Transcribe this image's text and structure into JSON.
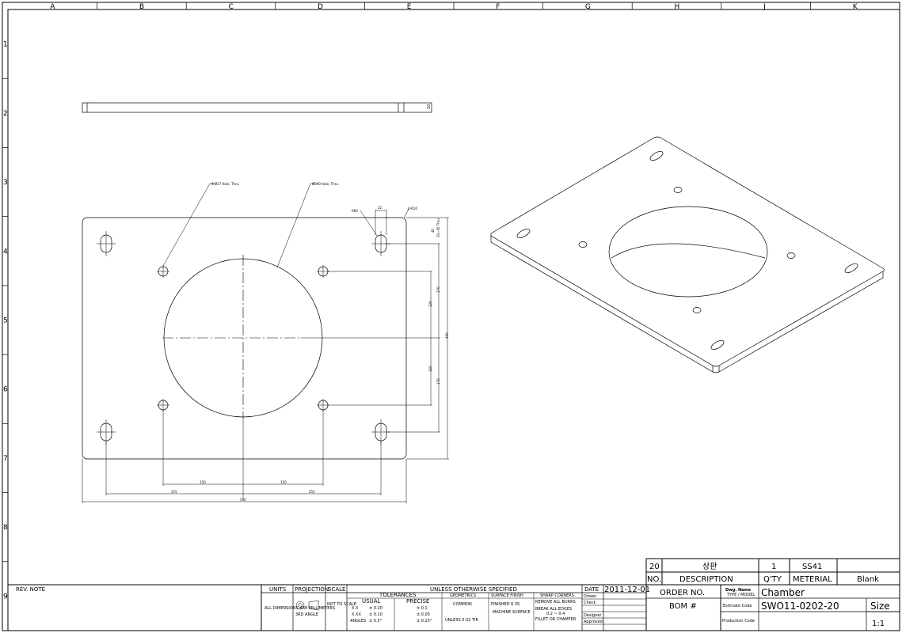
{
  "grid": {
    "columns": [
      "A",
      "B",
      "C",
      "D",
      "E",
      "F",
      "G",
      "H",
      "J",
      "K"
    ],
    "rows": [
      "1",
      "2",
      "3",
      "4",
      "5",
      "6",
      "7",
      "8",
      "9"
    ]
  },
  "annotations": {
    "hole_small": "4-Ø17 Hole, Thru.",
    "hole_large": "Ø390 Hole, Thru.",
    "r_slot": "R85",
    "r_corner": "4-R10",
    "slot_width": "22",
    "thickness": "10",
    "dim_bottom_inner": "150",
    "dim_bottom_inner2": "150",
    "dim_bottom_outer": "255",
    "dim_bottom_outer2": "255",
    "dim_bottom_total": "530",
    "dim_right_170a": "170",
    "dim_right_170b": "170",
    "dim_right_120a": "120",
    "dim_right_120b": "120",
    "dim_right_total": "450",
    "dim_right_top": "40",
    "dim_right_top2": "30~45 Thru."
  },
  "bom": {
    "row1": {
      "no": "20",
      "description": "상판",
      "qty": "1",
      "material": "SS41",
      "extra": ""
    },
    "header": {
      "no": "NO.",
      "description": "DESCRIPTION",
      "qty": "Q'TY",
      "material": "METERIAL",
      "extra": "Blank"
    },
    "order_label": "ORDER NO.",
    "dwg_label": "Dwg. Name",
    "dwg_sub": "TYPE / MODEL",
    "dwg_value": "Chamber",
    "bom_label": "BOM #",
    "estimate_label": "Estimate Code",
    "estimate_value": "SWO11-0202-20",
    "size_label": "Size",
    "production_label": "Production Code",
    "scale_value": "1:1"
  },
  "titleblock": {
    "rev_note": "REV. NOTE",
    "units": "UNITS",
    "projection": "PROJECTION",
    "scale": "SCALE",
    "unless": "UNLESS OTHERWISE SPECIFIED",
    "tolerances": "TOLERANCES",
    "usual": "USUAL",
    "precise": "PRECISE",
    "geometrics": "GEOMETRICS",
    "surface": "SURFACE FINISH",
    "sharp": "SHARP CORNERS",
    "date_label": "DATE",
    "date_value": "2011-12-01",
    "units_text": "ALL DIMENSIONS ARE MILLIMETERS",
    "proj_text": "3RD ANGLE",
    "scale_text": "NOT TO SCALE",
    "tol_x": "X.X",
    "tol_xx": "X.XX",
    "tol_angles": "ANGLES",
    "tol_v1": "± 0.20",
    "tol_v2": "± 0.10",
    "tol_v3": "± 0.5°",
    "pre_v1": "± 0.1",
    "pre_v2": "± 0.05",
    "pre_v3": "± 0.25°",
    "geo_text": "COMMON",
    "geo_sub": "UNLESS  0.02  TIR",
    "surf_text": "FINISHED  6.3S",
    "surf_sub": "MACHINE SURFACE",
    "sharp1": "REMOVE ALL BURRS",
    "sharp2": "BREAK ALL EDGES",
    "sharp3": "0.2 ~ 0.4",
    "sharp4": "FILLET OR CHAMFER",
    "sign_drawn": "Drawn",
    "sign_check": "Check",
    "sign_designer": "Designer",
    "sign_approved": "Approved"
  }
}
